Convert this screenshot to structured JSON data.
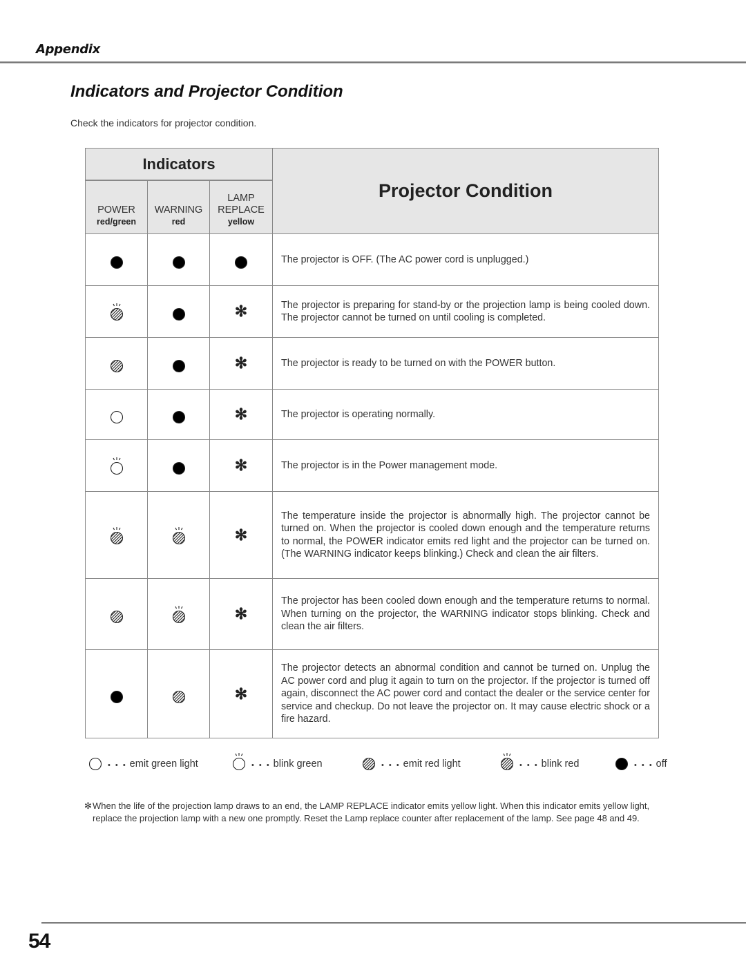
{
  "header": {
    "section": "Appendix",
    "title": "Indicators and Projector Condition",
    "intro": "Check the indicators for projector condition."
  },
  "table": {
    "indicators_heading": "Indicators",
    "condition_heading": "Projector Condition",
    "columns": [
      {
        "name": "POWER",
        "color": "red/green"
      },
      {
        "name": "WARNING",
        "color": "red"
      },
      {
        "name_line1": "LAMP",
        "name": "REPLACE",
        "color": "yellow"
      }
    ],
    "rows": [
      {
        "power": "off",
        "warning": "off",
        "lamp": "off",
        "condition": "The projector is OFF.  (The AC power cord is unplugged.)"
      },
      {
        "power": "blink-red",
        "warning": "off",
        "lamp": "asterisk",
        "condition": "The projector is preparing for stand-by or the projection lamp is being cooled down.  The projector cannot be turned on until cooling is completed."
      },
      {
        "power": "red",
        "warning": "off",
        "lamp": "asterisk",
        "condition": "The projector is ready to be turned on with the POWER button."
      },
      {
        "power": "green",
        "warning": "off",
        "lamp": "asterisk",
        "condition": "The projector is operating normally."
      },
      {
        "power": "blink-green",
        "warning": "off",
        "lamp": "asterisk",
        "condition": "The projector is in the Power management mode."
      },
      {
        "power": "blink-red",
        "warning": "blink-red",
        "lamp": "asterisk",
        "condition": "The temperature inside the projector is abnormally high.  The projector cannot be turned on.  When  the projector is cooled down enough and the temperature returns to normal, the POWER indicator emits red light and the projector can be turned on.  (The WARNING indicator keeps blinking.) Check and clean the air filters."
      },
      {
        "power": "red",
        "warning": "blink-red",
        "lamp": "asterisk",
        "condition": "The projector has been cooled down enough and the temperature returns to normal.  When turning on the projector, the WARNING indicator stops blinking.  Check and clean the air filters."
      },
      {
        "power": "off",
        "warning": "red",
        "lamp": "asterisk",
        "condition": "The projector detects an abnormal condition and cannot be turned on.  Unplug the AC power cord and plug it again to turn on the projector.  If the projector is turned off again, disconnect the AC power cord and contact the dealer or the service center for service and checkup.  Do not leave the projector on.  It may cause electric shock or a fire hazard."
      }
    ]
  },
  "legend": [
    {
      "icon": "green",
      "dots": "• • •",
      "label": "emit green light"
    },
    {
      "icon": "blink-green",
      "dots": "• • •",
      "label": "blink green"
    },
    {
      "icon": "red",
      "dots": "• • •",
      "label": "emit red light"
    },
    {
      "icon": "blink-red",
      "dots": "• • •",
      "label": "blink red"
    },
    {
      "icon": "off",
      "dots": "• • •",
      "label": "off"
    }
  ],
  "footnote": {
    "mark": "✻",
    "text": "When the life of the projection lamp draws to an end, the LAMP REPLACE indicator emits yellow light.  When this indicator emits yellow light, replace the projection lamp with a new one promptly.  Reset the Lamp replace counter after replacement of the lamp.  See page 48 and 49."
  },
  "page_number": "54",
  "colors": {
    "header_bg": "#e6e6e6",
    "rule": "#7a7a7a",
    "border": "#888888"
  }
}
